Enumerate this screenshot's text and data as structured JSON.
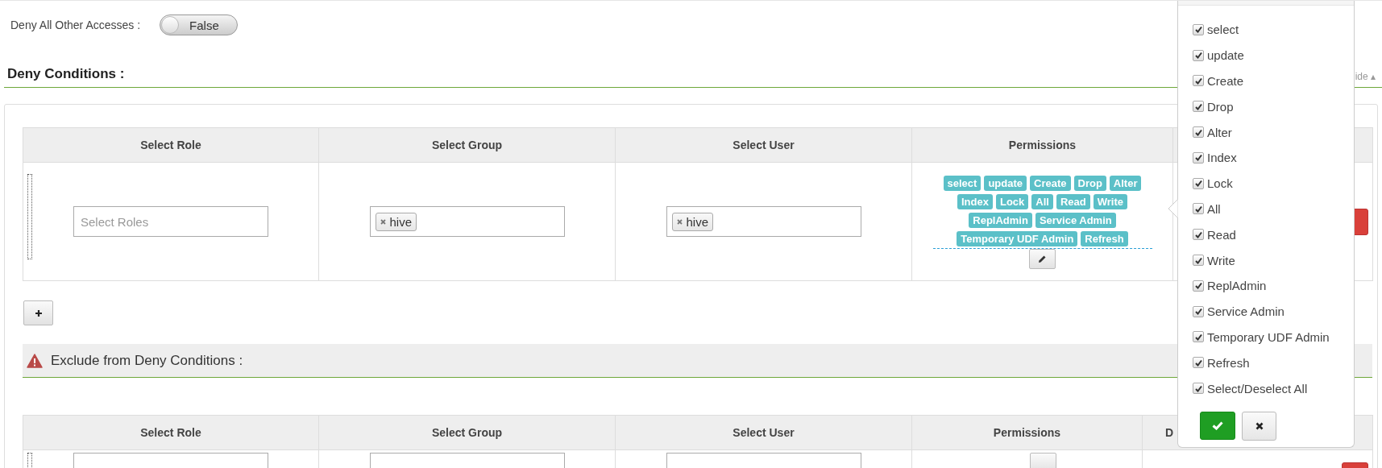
{
  "deny_all_other_accesses": {
    "label": "Deny All Other Accesses :",
    "toggle": {
      "label": "False",
      "on": false
    }
  },
  "deny_conditions": {
    "title": "Deny Conditions :",
    "hide_link": "ide ▴",
    "table": {
      "columns": [
        "Select Role",
        "Select Group",
        "Select User",
        "Permissions"
      ],
      "rows": [
        {
          "role_placeholder": "Select Roles",
          "groups": [
            "hive"
          ],
          "users": [
            "hive"
          ],
          "permissions": [
            "select",
            "update",
            "Create",
            "Drop",
            "Alter",
            "Index",
            "Lock",
            "All",
            "Read",
            "Write",
            "ReplAdmin",
            "Service Admin",
            "Temporary UDF Admin",
            "Refresh"
          ]
        }
      ]
    }
  },
  "exclude_from_deny_conditions": {
    "title": "Exclude from Deny Conditions :",
    "table": {
      "columns": [
        "Select Role",
        "Select Group",
        "Select User",
        "Permissions",
        "D"
      ]
    }
  },
  "permissions_popup": {
    "items": [
      {
        "label": "select",
        "checked": true
      },
      {
        "label": "update",
        "checked": true
      },
      {
        "label": "Create",
        "checked": true
      },
      {
        "label": "Drop",
        "checked": true
      },
      {
        "label": "Alter",
        "checked": true
      },
      {
        "label": "Index",
        "checked": true
      },
      {
        "label": "Lock",
        "checked": true
      },
      {
        "label": "All",
        "checked": true
      },
      {
        "label": "Read",
        "checked": true
      },
      {
        "label": "Write",
        "checked": true
      },
      {
        "label": "ReplAdmin",
        "checked": true
      },
      {
        "label": "Service Admin",
        "checked": true
      },
      {
        "label": "Temporary UDF Admin",
        "checked": true
      },
      {
        "label": "Refresh",
        "checked": true
      },
      {
        "label": "Select/Deselect All",
        "checked": true
      }
    ]
  }
}
